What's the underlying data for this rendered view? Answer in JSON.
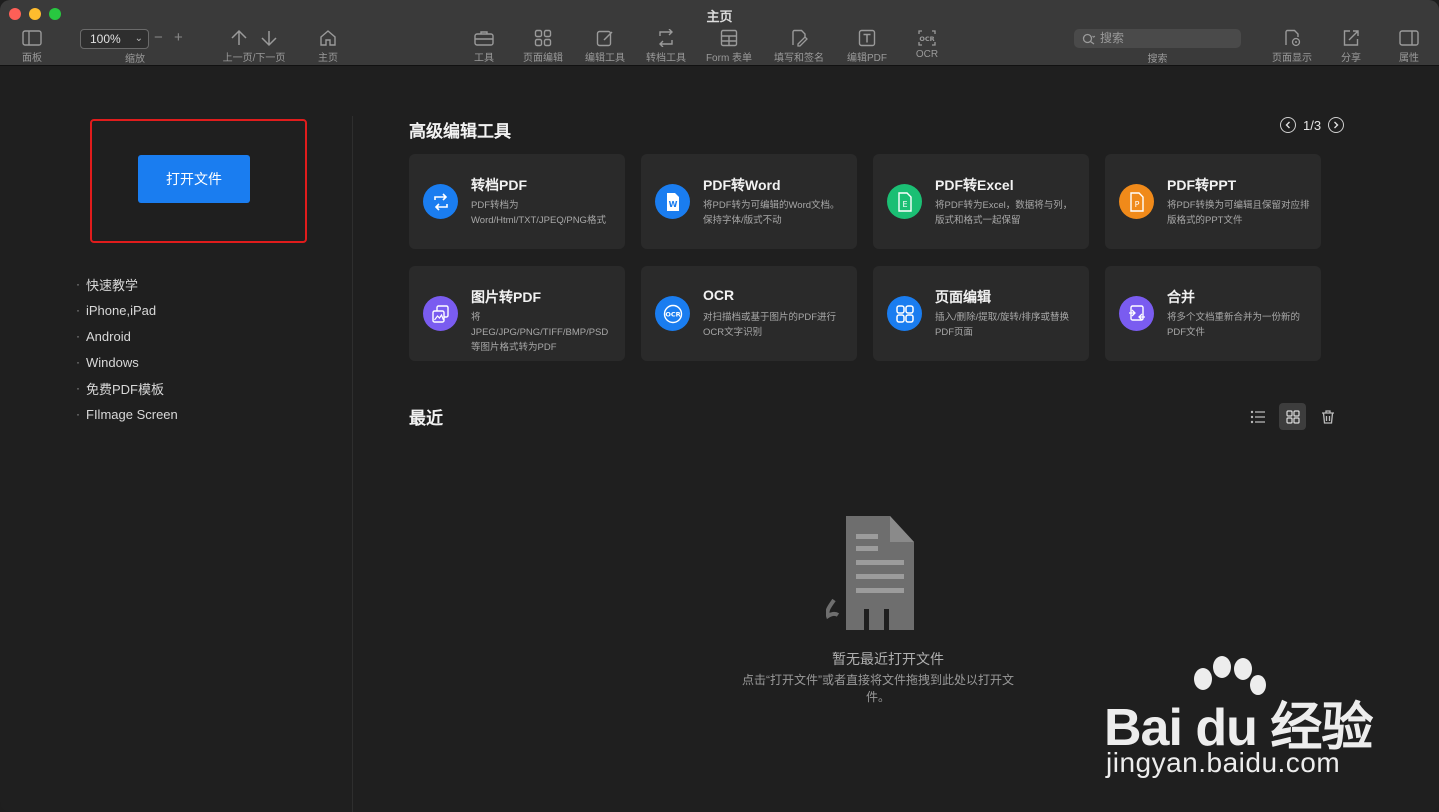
{
  "window": {
    "title": "主页"
  },
  "toolbar": {
    "panel_label": "面板",
    "zoom_value": "100%",
    "zoom_label": "缩放",
    "prevnext_label": "上一页/下一页",
    "home_label": "主页",
    "tools_label": "工具",
    "page_edit_label": "页面编辑",
    "edit_tools_label": "编辑工具",
    "convert_label": "转档工具",
    "form_label": "Form 表单",
    "sign_label": "填写和签名",
    "edit_pdf_label": "编辑PDF",
    "ocr_label": "OCR",
    "search_placeholder": "搜索",
    "search_label": "搜索",
    "page_display_label": "页面显示",
    "share_label": "分享",
    "properties_label": "属性"
  },
  "sidebar": {
    "open_button": "打开文件",
    "links": [
      "快速教学",
      "iPhone,iPad",
      "Android",
      "Windows",
      "免费PDF模板",
      "FIlmage Screen"
    ]
  },
  "tools_section": {
    "title": "高级编辑工具",
    "pager": "1/3",
    "cards": [
      {
        "title": "转档PDF",
        "desc": "PDF转档为Word/Html/TXT/JPEQ/PNG格式",
        "icon": "convert-icon",
        "color": "#1a7df0"
      },
      {
        "title": "PDF转Word",
        "desc": "将PDF转为可编辑的Word文档。保持字体/版式不动",
        "icon": "word-icon",
        "color": "#1a7df0"
      },
      {
        "title": "PDF转Excel",
        "desc": "将PDF转为Excel，数据将与列，版式和格式一起保留",
        "icon": "excel-icon",
        "color": "#1bbf74"
      },
      {
        "title": "PDF转PPT",
        "desc": "将PDF转换为可编辑且保留对应排版格式的PPT文件",
        "icon": "ppt-icon",
        "color": "#f08a1a"
      },
      {
        "title": "图片转PDF",
        "desc": "将JPEG/JPG/PNG/TIFF/BMP/PSD等图片格式转为PDF",
        "icon": "image-icon",
        "color": "#7a5cf0"
      },
      {
        "title": "OCR",
        "desc": "对扫描档或基于图片的PDF进行OCR文字识别",
        "icon": "ocr-icon",
        "color": "#1a7df0"
      },
      {
        "title": "页面编辑",
        "desc": "插入/删除/提取/旋转/排序或替换PDF页面",
        "icon": "grid-icon",
        "color": "#1a7df0"
      },
      {
        "title": "合并",
        "desc": "将多个文档重新合并为一份新的PDF文件",
        "icon": "merge-icon",
        "color": "#7a5cf0"
      }
    ]
  },
  "recent_section": {
    "title": "最近",
    "empty_title": "暂无最近打开文件",
    "empty_desc": "点击“打开文件”或者直接将文件拖拽到此处以打开文件。"
  },
  "watermark": {
    "brand": "Bai du 经验",
    "url": "jingyan.baidu.com"
  }
}
